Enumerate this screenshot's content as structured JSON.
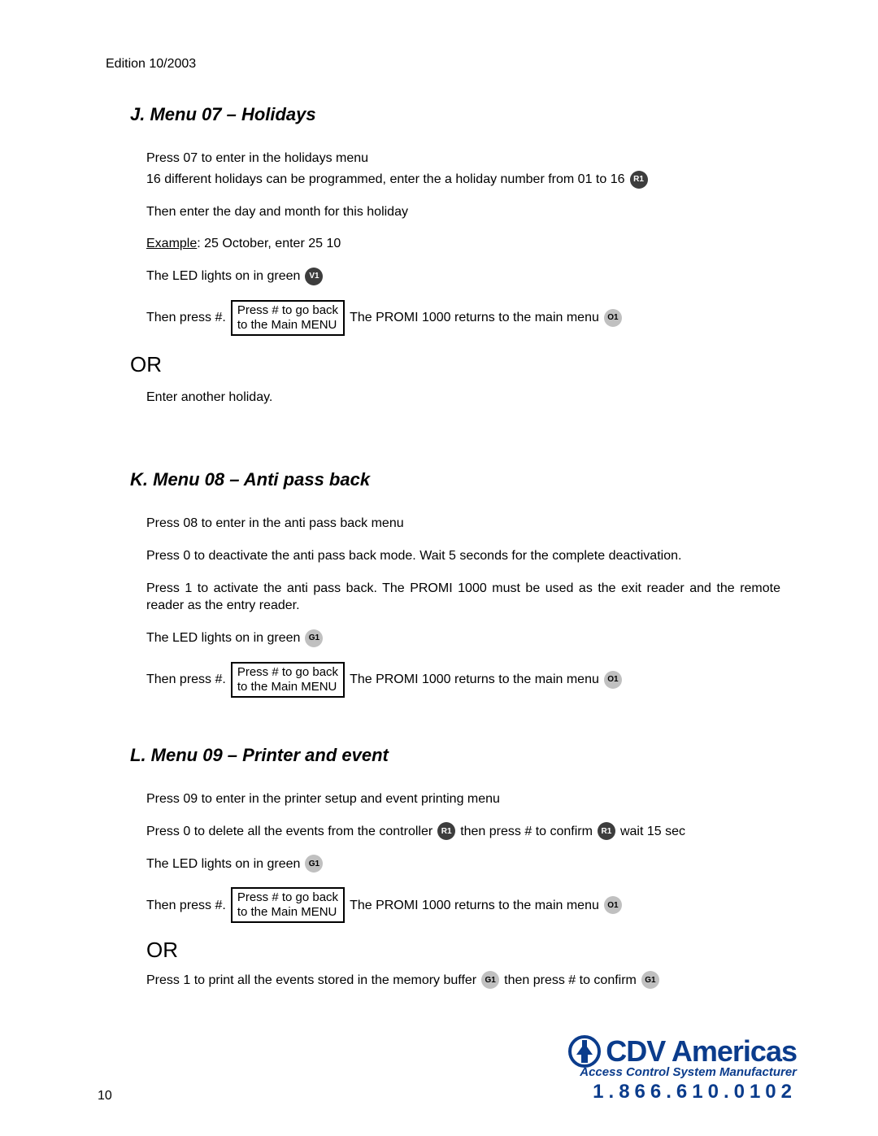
{
  "edition": "Edition 10/2003",
  "sectionJ": {
    "heading": "J.  Menu 07 – Holidays",
    "p1": "Press 07 to enter in the holidays menu",
    "p2a": "16 different holidays can be programmed, enter the a holiday number from 01 to 16",
    "badge_r1": "R1",
    "p3": "Then enter the day and month for this holiday",
    "ex_label": "Example",
    "ex_rest": ": 25 October, enter  25 10",
    "led": "The LED lights on in green",
    "badge_v1": "V1",
    "press_hash": "Then press #.",
    "box_l1": "Press # to go back",
    "box_l2": "to the Main MENU",
    "returns": "The PROMI 1000 returns to the main menu",
    "badge_o1": "O1",
    "or": "OR",
    "enter_another": "Enter another holiday."
  },
  "sectionK": {
    "heading": "K.  Menu 08 – Anti pass back",
    "p1": "Press 08 to enter in the anti pass back menu",
    "p2": "Press 0 to deactivate the anti pass back mode. Wait 5 seconds for the complete deactivation.",
    "p3": "Press 1 to activate the anti pass back. The PROMI 1000 must be used as the exit reader and the remote reader as the entry reader.",
    "led": "The LED lights on in green",
    "badge_g1": "G1",
    "press_hash": "Then press #.",
    "box_l1": "Press # to go back",
    "box_l2": "to the Main MENU",
    "returns": "The PROMI 1000 returns to the main menu",
    "badge_o1": "O1"
  },
  "sectionL": {
    "heading": "L.  Menu 09 – Printer and event",
    "p1": "Press 09 to enter in the printer setup and event printing menu",
    "p2a": "Press 0 to delete all the events from the controller",
    "badge_r1": "R1",
    "p2b": "then press # to confirm",
    "badge_r1b": "R1",
    "p2c": "wait 15 sec",
    "led": "The LED lights on in green",
    "badge_g1": "G1",
    "press_hash": "Then press #.",
    "box_l1": "Press # to go back",
    "box_l2": "to the Main MENU",
    "returns": "The PROMI 1000 returns to the main menu",
    "badge_o1": "O1",
    "or": "OR",
    "p3a": "Press 1 to print all the events stored in the memory buffer",
    "badge_g1b": "G1",
    "p3b": "then press # to confirm",
    "badge_g1c": "G1"
  },
  "footer": {
    "page": "10",
    "brand": "CDV Americas",
    "tag": "Access Control System Manufacturer",
    "phone": "1.866.610.0102"
  }
}
